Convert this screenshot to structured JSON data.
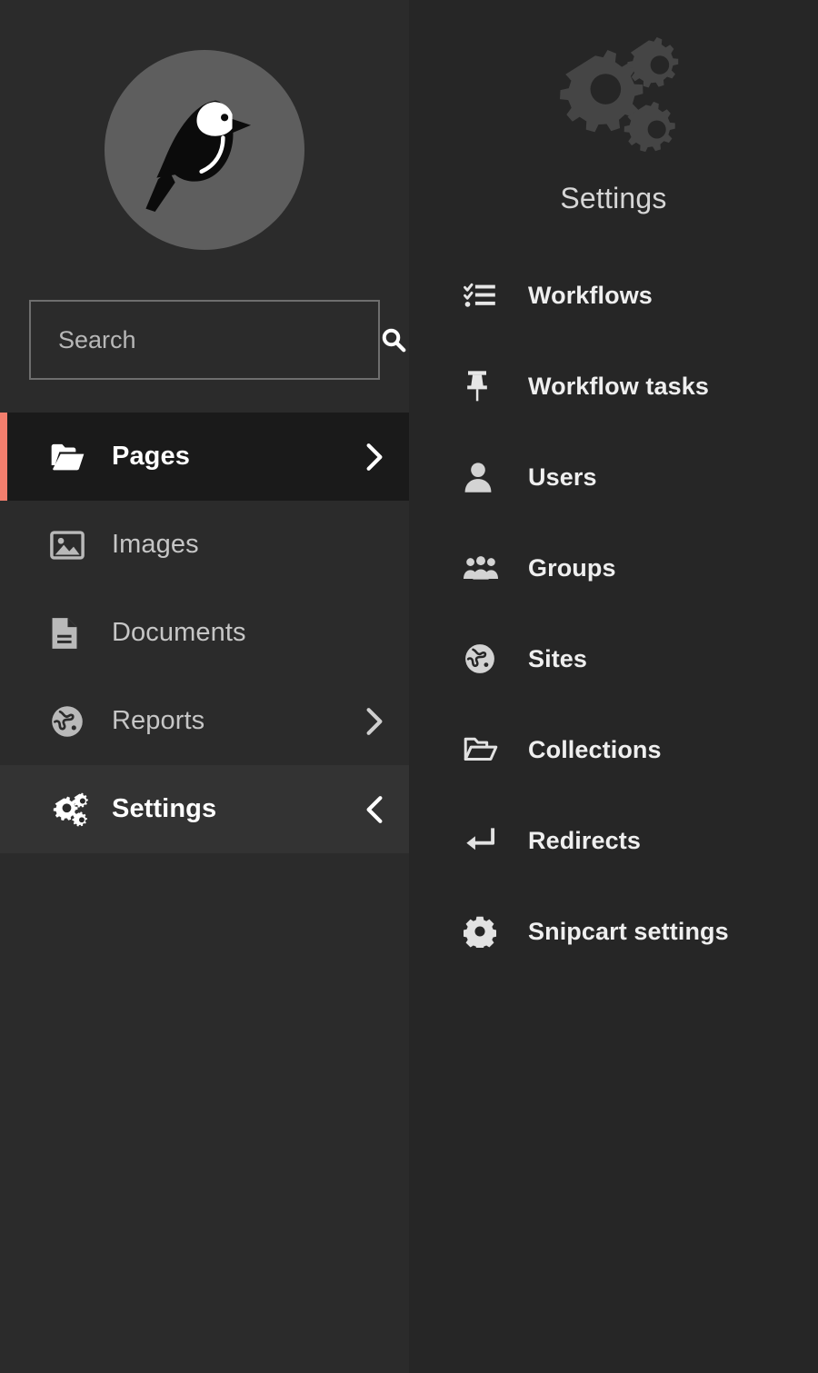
{
  "colors": {
    "main_nav_bg": "#2b2b2b",
    "sub_nav_bg": "#262626",
    "active_row_bg": "#1a1a1a",
    "open_row_bg": "#333333",
    "accent": "#f37e6d",
    "logo_circle": "#5e5e5e",
    "label": "#c6c6c6",
    "label_active": "#ffffff"
  },
  "logo": {
    "name": "wagtail-bird-logo",
    "alt": "Wagtail"
  },
  "search": {
    "placeholder": "Search",
    "value": "",
    "icon": "search-icon",
    "button_label": "Search"
  },
  "main_menu": {
    "items": [
      {
        "label": "Pages",
        "icon": "folder-open-icon",
        "arrow": "chevron-right-icon",
        "state": "active"
      },
      {
        "label": "Images",
        "icon": "image-icon",
        "arrow": "",
        "state": ""
      },
      {
        "label": "Documents",
        "icon": "document-icon",
        "arrow": "",
        "state": ""
      },
      {
        "label": "Reports",
        "icon": "globe-icon",
        "arrow": "chevron-right-icon",
        "state": ""
      },
      {
        "label": "Settings",
        "icon": "gears-icon",
        "arrow": "chevron-left-icon",
        "state": "open"
      }
    ]
  },
  "sub_menu": {
    "title": "Settings",
    "header_icon": "gears-icon",
    "items": [
      {
        "label": "Workflows",
        "icon": "tasks-list-icon"
      },
      {
        "label": "Workflow tasks",
        "icon": "pin-icon"
      },
      {
        "label": "Users",
        "icon": "user-icon"
      },
      {
        "label": "Groups",
        "icon": "group-icon"
      },
      {
        "label": "Sites",
        "icon": "globe-icon"
      },
      {
        "label": "Collections",
        "icon": "folder-open-outline-icon"
      },
      {
        "label": "Redirects",
        "icon": "redirect-arrow-icon"
      },
      {
        "label": "Snipcart settings",
        "icon": "gear-icon"
      }
    ]
  }
}
